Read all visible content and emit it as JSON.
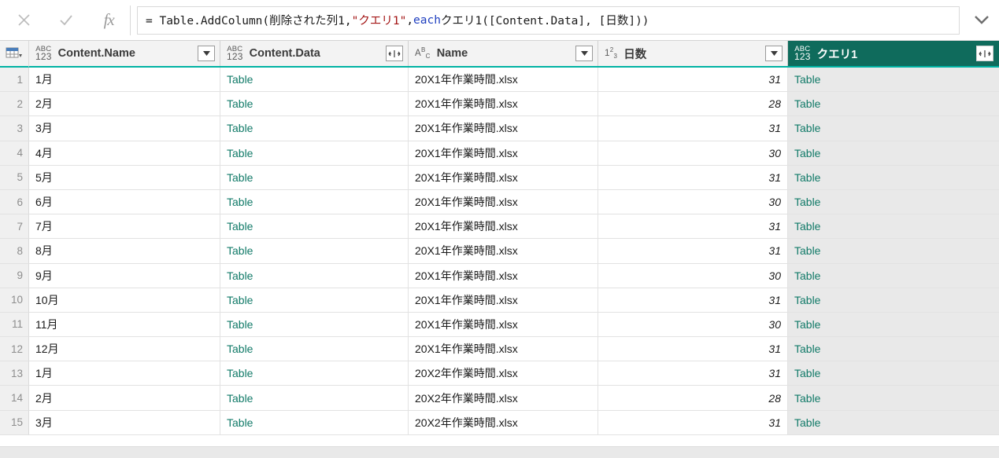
{
  "formula_bar": {
    "cancel_icon": "close-icon",
    "accept_icon": "checkmark-icon",
    "fx_label": "fx",
    "expand_icon": "chevron-down-icon",
    "formula_full": "= Table.AddColumn(削除された列1, \"クエリ1\", each クエリ1([Content.Data], [日数]))",
    "tokens": {
      "part1": "= Table.AddColumn(削除された列1, ",
      "string": "\"クエリ1\"",
      "comma": ", ",
      "keyword": "each",
      "part2": " クエリ1([Content.Data], [日数]))"
    }
  },
  "grid": {
    "corner_icon": "table-select-icon",
    "columns": [
      {
        "label": "Content.Name",
        "type_icon": "abc123-any-type-icon",
        "button": "filter-dropdown-icon",
        "selected": false
      },
      {
        "label": "Content.Data",
        "type_icon": "abc123-any-type-icon",
        "button": "expand-columns-icon",
        "selected": false
      },
      {
        "label": "Name",
        "type_icon": "abc-text-type-icon",
        "button": "filter-dropdown-icon",
        "selected": false
      },
      {
        "label": "日数",
        "type_icon": "123-number-type-icon",
        "button": "filter-dropdown-icon",
        "selected": false
      },
      {
        "label": "クエリ1",
        "type_icon": "abc123-any-type-icon",
        "button": "expand-columns-icon",
        "selected": true
      }
    ],
    "rows": [
      {
        "n": "1",
        "content_name": "1月",
        "content_data": "Table",
        "name": "20X1年作業時間.xlsx",
        "days": "31",
        "query1": "Table"
      },
      {
        "n": "2",
        "content_name": "2月",
        "content_data": "Table",
        "name": "20X1年作業時間.xlsx",
        "days": "28",
        "query1": "Table"
      },
      {
        "n": "3",
        "content_name": "3月",
        "content_data": "Table",
        "name": "20X1年作業時間.xlsx",
        "days": "31",
        "query1": "Table"
      },
      {
        "n": "4",
        "content_name": "4月",
        "content_data": "Table",
        "name": "20X1年作業時間.xlsx",
        "days": "30",
        "query1": "Table"
      },
      {
        "n": "5",
        "content_name": "5月",
        "content_data": "Table",
        "name": "20X1年作業時間.xlsx",
        "days": "31",
        "query1": "Table"
      },
      {
        "n": "6",
        "content_name": "6月",
        "content_data": "Table",
        "name": "20X1年作業時間.xlsx",
        "days": "30",
        "query1": "Table"
      },
      {
        "n": "7",
        "content_name": "7月",
        "content_data": "Table",
        "name": "20X1年作業時間.xlsx",
        "days": "31",
        "query1": "Table"
      },
      {
        "n": "8",
        "content_name": "8月",
        "content_data": "Table",
        "name": "20X1年作業時間.xlsx",
        "days": "31",
        "query1": "Table"
      },
      {
        "n": "9",
        "content_name": "9月",
        "content_data": "Table",
        "name": "20X1年作業時間.xlsx",
        "days": "30",
        "query1": "Table"
      },
      {
        "n": "10",
        "content_name": "10月",
        "content_data": "Table",
        "name": "20X1年作業時間.xlsx",
        "days": "31",
        "query1": "Table"
      },
      {
        "n": "11",
        "content_name": "11月",
        "content_data": "Table",
        "name": "20X1年作業時間.xlsx",
        "days": "30",
        "query1": "Table"
      },
      {
        "n": "12",
        "content_name": "12月",
        "content_data": "Table",
        "name": "20X1年作業時間.xlsx",
        "days": "31",
        "query1": "Table"
      },
      {
        "n": "13",
        "content_name": "1月",
        "content_data": "Table",
        "name": "20X2年作業時間.xlsx",
        "days": "31",
        "query1": "Table"
      },
      {
        "n": "14",
        "content_name": "2月",
        "content_data": "Table",
        "name": "20X2年作業時間.xlsx",
        "days": "28",
        "query1": "Table"
      },
      {
        "n": "15",
        "content_name": "3月",
        "content_data": "Table",
        "name": "20X2年作業時間.xlsx",
        "days": "31",
        "query1": "Table"
      }
    ]
  },
  "colors": {
    "accent_teal": "#00b2a3",
    "selected_header": "#0f6b5c",
    "link_text": "#117a68",
    "selected_column_bg": "#e9e9e9",
    "header_bg": "#f3f3f3",
    "formula_string": "#a31515",
    "formula_keyword": "#1f3fbf"
  }
}
